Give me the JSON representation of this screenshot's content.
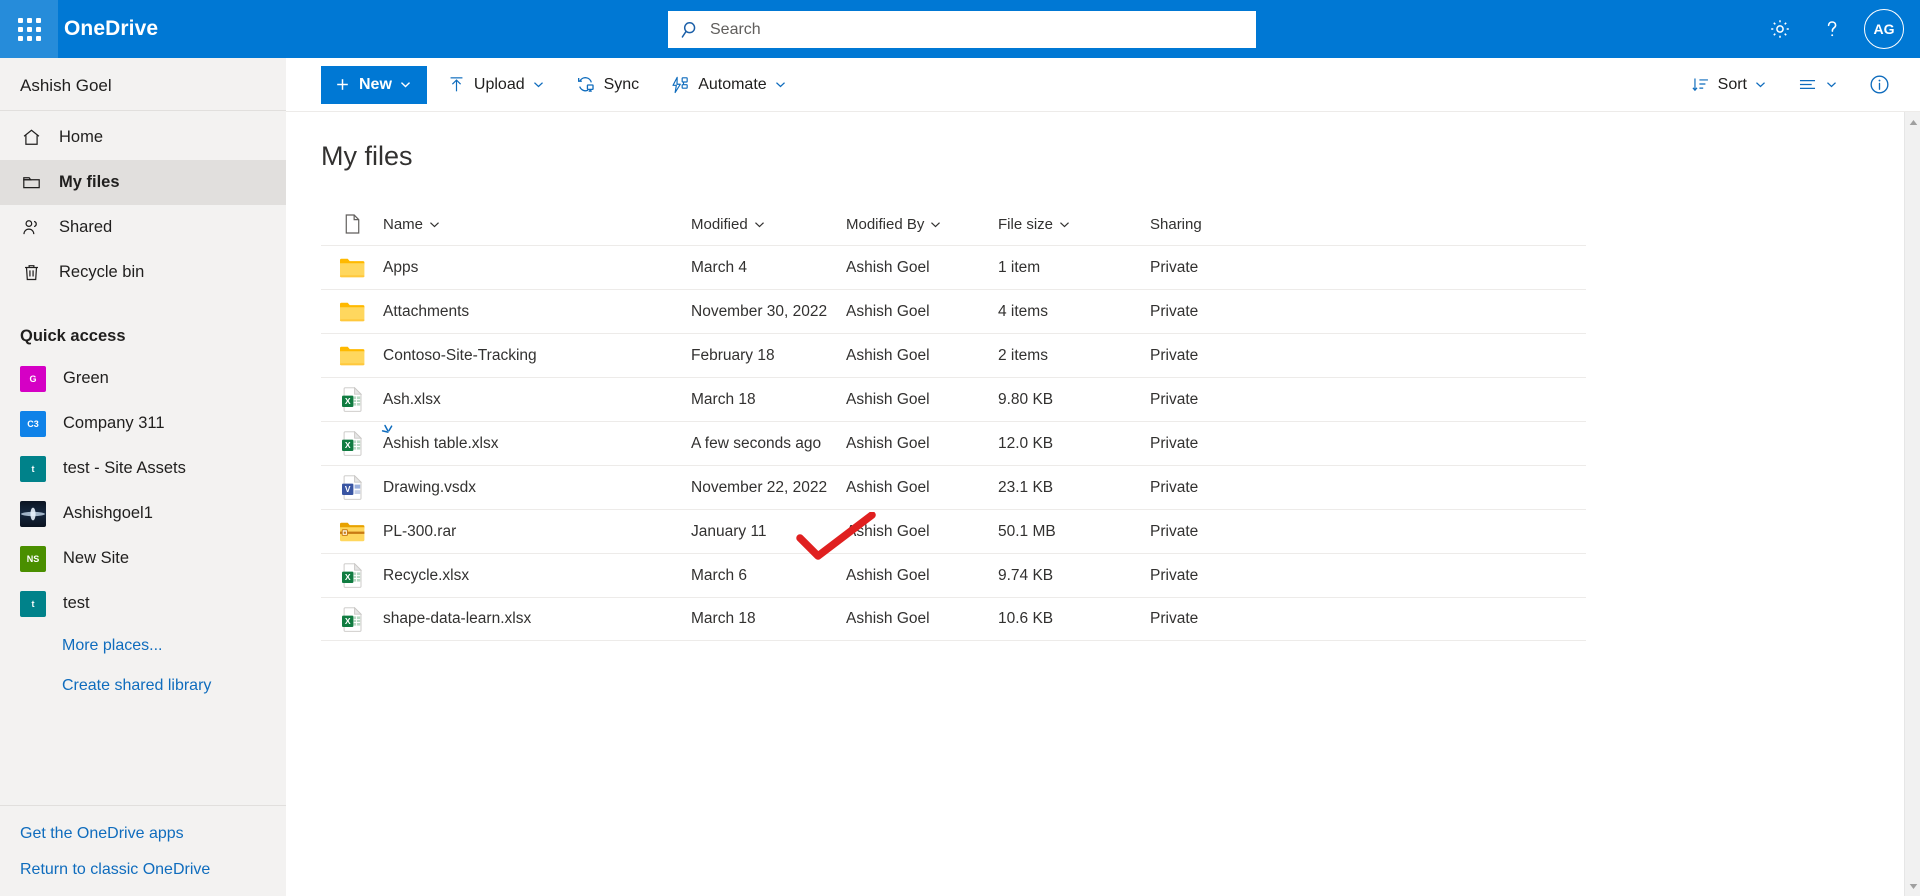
{
  "suite": {
    "waffle_label": "App launcher",
    "brand": "OneDrive",
    "settings_label": "Settings",
    "help_label": "Help",
    "avatar_initials": "AG"
  },
  "search": {
    "placeholder": "Search",
    "value": ""
  },
  "sidebar": {
    "owner": "Ashish Goel",
    "items": [
      {
        "label": "Home",
        "icon": "home-icon",
        "selected": false
      },
      {
        "label": "My files",
        "icon": "folder-icon",
        "selected": true
      },
      {
        "label": "Shared",
        "icon": "people-icon",
        "selected": false
      },
      {
        "label": "Recycle bin",
        "icon": "trash-icon",
        "selected": false
      }
    ],
    "quick_access_title": "Quick access",
    "quick_access": [
      {
        "label": "Green",
        "initials": "G",
        "color": "#d500c5",
        "image": false
      },
      {
        "label": "Company 311",
        "initials": "C3",
        "color": "#0f82e8",
        "image": false
      },
      {
        "label": "test - Site Assets",
        "initials": "t",
        "color": "#00828a",
        "image": false
      },
      {
        "label": "Ashishgoel1",
        "initials": "",
        "color": "#2a3a4f",
        "image": true
      },
      {
        "label": "New Site",
        "initials": "NS",
        "color": "#4a8f00",
        "image": false
      },
      {
        "label": "test",
        "initials": "t",
        "color": "#00828a",
        "image": false
      }
    ],
    "links": [
      "More places...",
      "Create shared library"
    ],
    "bottom_links": [
      "Get the OneDrive apps",
      "Return to classic OneDrive"
    ]
  },
  "toolbar": {
    "new_label": "New",
    "upload_label": "Upload",
    "sync_label": "Sync",
    "automate_label": "Automate",
    "sort_label": "Sort",
    "view_label": "View options",
    "info_label": "Details"
  },
  "main": {
    "title": "My files",
    "columns": [
      {
        "label": "",
        "sortable": false
      },
      {
        "label": "Name",
        "sortable": true
      },
      {
        "label": "Modified",
        "sortable": true
      },
      {
        "label": "Modified By",
        "sortable": true
      },
      {
        "label": "File size",
        "sortable": true
      },
      {
        "label": "Sharing",
        "sortable": false
      }
    ],
    "rows": [
      {
        "name": "Apps",
        "type": "folder",
        "modified": "March 4",
        "modified_by": "Ashish Goel",
        "size": "1 item",
        "sharing": "Private",
        "is_new": false
      },
      {
        "name": "Attachments",
        "type": "folder",
        "modified": "November 30, 2022",
        "modified_by": "Ashish Goel",
        "size": "4 items",
        "sharing": "Private",
        "is_new": false
      },
      {
        "name": "Contoso-Site-Tracking",
        "type": "folder",
        "modified": "February 18",
        "modified_by": "Ashish Goel",
        "size": "2 items",
        "sharing": "Private",
        "is_new": false
      },
      {
        "name": "Ash.xlsx",
        "type": "excel",
        "modified": "March 18",
        "modified_by": "Ashish Goel",
        "size": "9.80 KB",
        "sharing": "Private",
        "is_new": false
      },
      {
        "name": "Ashish table.xlsx",
        "type": "excel",
        "modified": "A few seconds ago",
        "modified_by": "Ashish Goel",
        "size": "12.0 KB",
        "sharing": "Private",
        "is_new": true
      },
      {
        "name": "Drawing.vsdx",
        "type": "visio",
        "modified": "November 22, 2022",
        "modified_by": "Ashish Goel",
        "size": "23.1 KB",
        "sharing": "Private",
        "is_new": false
      },
      {
        "name": "PL-300.rar",
        "type": "archive",
        "modified": "January 11",
        "modified_by": "Ashish Goel",
        "size": "50.1 MB",
        "sharing": "Private",
        "is_new": false
      },
      {
        "name": "Recycle.xlsx",
        "type": "excel",
        "modified": "March 6",
        "modified_by": "Ashish Goel",
        "size": "9.74 KB",
        "sharing": "Private",
        "is_new": false
      },
      {
        "name": "shape-data-learn.xlsx",
        "type": "excel",
        "modified": "March 18",
        "modified_by": "Ashish Goel",
        "size": "10.6 KB",
        "sharing": "Private",
        "is_new": false
      }
    ]
  },
  "annotation": {
    "shape": "check-mark",
    "color": "#e02020"
  },
  "colors": {
    "brand_blue": "#0078d4",
    "link_blue": "#0f6cbd",
    "nav_bg": "#f3f2f1",
    "selected_bg": "#e1dfdd",
    "excel_green": "#107c41",
    "visio_blue": "#3955a3",
    "folder_yellow": "#ffc20e"
  }
}
